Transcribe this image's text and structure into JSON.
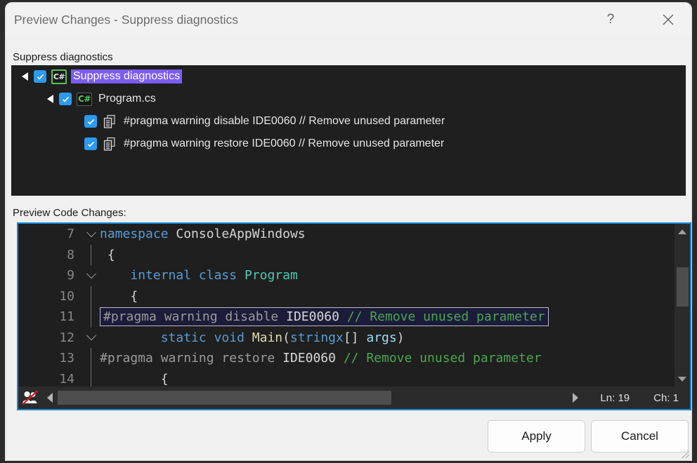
{
  "window": {
    "title": "Preview Changes - Suppress diagnostics",
    "help_glyph": "?",
    "help_icon": "question-mark-icon",
    "close_icon": "close-icon"
  },
  "tree_section": {
    "label": "Suppress diagnostics",
    "items": [
      {
        "label": "Suppress diagnostics",
        "icon": "csharp-project-icon",
        "checked": true,
        "expanded": true,
        "selected": true,
        "depth": 0
      },
      {
        "label": "Program.cs",
        "icon": "csharp-file-icon",
        "checked": true,
        "expanded": true,
        "selected": false,
        "depth": 1
      },
      {
        "label": "#pragma warning disable IDE0060 // Remove unused parameter",
        "icon": "code-change-icon",
        "checked": true,
        "expanded": false,
        "selected": false,
        "depth": 2
      },
      {
        "label": "#pragma warning restore IDE0060 // Remove unused parameter",
        "icon": "code-change-icon",
        "checked": true,
        "expanded": false,
        "selected": false,
        "depth": 2
      }
    ]
  },
  "code_section": {
    "label": "Preview Code Changes:",
    "lines": [
      {
        "number": "7",
        "gutter": "chevron",
        "highlighted": false,
        "tokens": [
          {
            "text": "namespace",
            "cls": "k"
          },
          {
            "text": " ConsoleAppWindows",
            "cls": "ctext"
          }
        ]
      },
      {
        "number": "8",
        "gutter": "vline",
        "highlighted": false,
        "tokens": [
          {
            "text": " {",
            "cls": "ctext"
          }
        ]
      },
      {
        "number": "9",
        "gutter": "chevron",
        "highlighted": false,
        "tokens": [
          {
            "text": "    ",
            "cls": "ctext"
          },
          {
            "text": "internal",
            "cls": "k"
          },
          {
            "text": " ",
            "cls": "ctext"
          },
          {
            "text": "class",
            "cls": "k"
          },
          {
            "text": " ",
            "cls": "ctext"
          },
          {
            "text": "Program",
            "cls": "t"
          }
        ]
      },
      {
        "number": "10",
        "gutter": "vline",
        "highlighted": false,
        "tokens": [
          {
            "text": "    {",
            "cls": "ctext"
          }
        ]
      },
      {
        "number": "11",
        "gutter": "vline",
        "highlighted": true,
        "tokens": [
          {
            "text": "#pragma",
            "cls": "pp"
          },
          {
            "text": " ",
            "cls": "ctext"
          },
          {
            "text": "warning",
            "cls": "pp"
          },
          {
            "text": " ",
            "cls": "ctext"
          },
          {
            "text": "disable",
            "cls": "pp"
          },
          {
            "text": " ",
            "cls": "ctext"
          },
          {
            "text": "IDE0060",
            "cls": "ppw"
          },
          {
            "text": " ",
            "cls": "ctext"
          },
          {
            "text": "// Remove unused parameter",
            "cls": "c"
          }
        ]
      },
      {
        "number": "12",
        "gutter": "chevron",
        "highlighted": false,
        "tokens": [
          {
            "text": "        ",
            "cls": "ctext"
          },
          {
            "text": "static",
            "cls": "k"
          },
          {
            "text": " ",
            "cls": "ctext"
          },
          {
            "text": "void",
            "cls": "k"
          },
          {
            "text": " ",
            "cls": "ctext"
          },
          {
            "text": "Main",
            "cls": "m"
          },
          {
            "text": "(",
            "cls": "ctext"
          },
          {
            "text": "stringx",
            "cls": "k"
          },
          {
            "text": "[] ",
            "cls": "ctext"
          },
          {
            "text": "args",
            "cls": "p"
          },
          {
            "text": ")",
            "cls": "ctext"
          }
        ]
      },
      {
        "number": "13",
        "gutter": "vline",
        "highlighted": false,
        "tokens": [
          {
            "text": "#pragma",
            "cls": "pp"
          },
          {
            "text": " ",
            "cls": "ctext"
          },
          {
            "text": "warning",
            "cls": "pp"
          },
          {
            "text": " ",
            "cls": "ctext"
          },
          {
            "text": "restore",
            "cls": "pp"
          },
          {
            "text": " ",
            "cls": "ctext"
          },
          {
            "text": "IDE0060",
            "cls": "ppw"
          },
          {
            "text": " ",
            "cls": "ctext"
          },
          {
            "text": "// Remove unused parameter",
            "cls": "c"
          }
        ]
      },
      {
        "number": "14",
        "gutter": "vline",
        "highlighted": false,
        "tokens": [
          {
            "text": "        {",
            "cls": "ctext"
          }
        ]
      }
    ],
    "statusbar": {
      "sync_icon": "no-sync-people-icon",
      "line_label": "Ln: 19",
      "column_label": "Ch: 1",
      "scroll_left_icon": "scroll-left-arrow-icon",
      "scroll_right_icon": "scroll-right-arrow-icon"
    },
    "vertical_scrollbar": {
      "up_icon": "scroll-up-arrow-icon",
      "down_icon": "scroll-down-arrow-icon"
    }
  },
  "footer": {
    "apply_label": "Apply",
    "cancel_label": "Cancel"
  },
  "colors": {
    "accent_focus": "#1b8ad6",
    "selection": "#7a5df5",
    "checkbox": "#2b9af3",
    "editor_bg": "#1f1f1f",
    "dialog_bg": "#f0f0f0",
    "keyword": "#569cd6",
    "type": "#4ec9b0",
    "method": "#dcdcaa",
    "param": "#9cdcfe",
    "comment": "#4ca64c"
  }
}
